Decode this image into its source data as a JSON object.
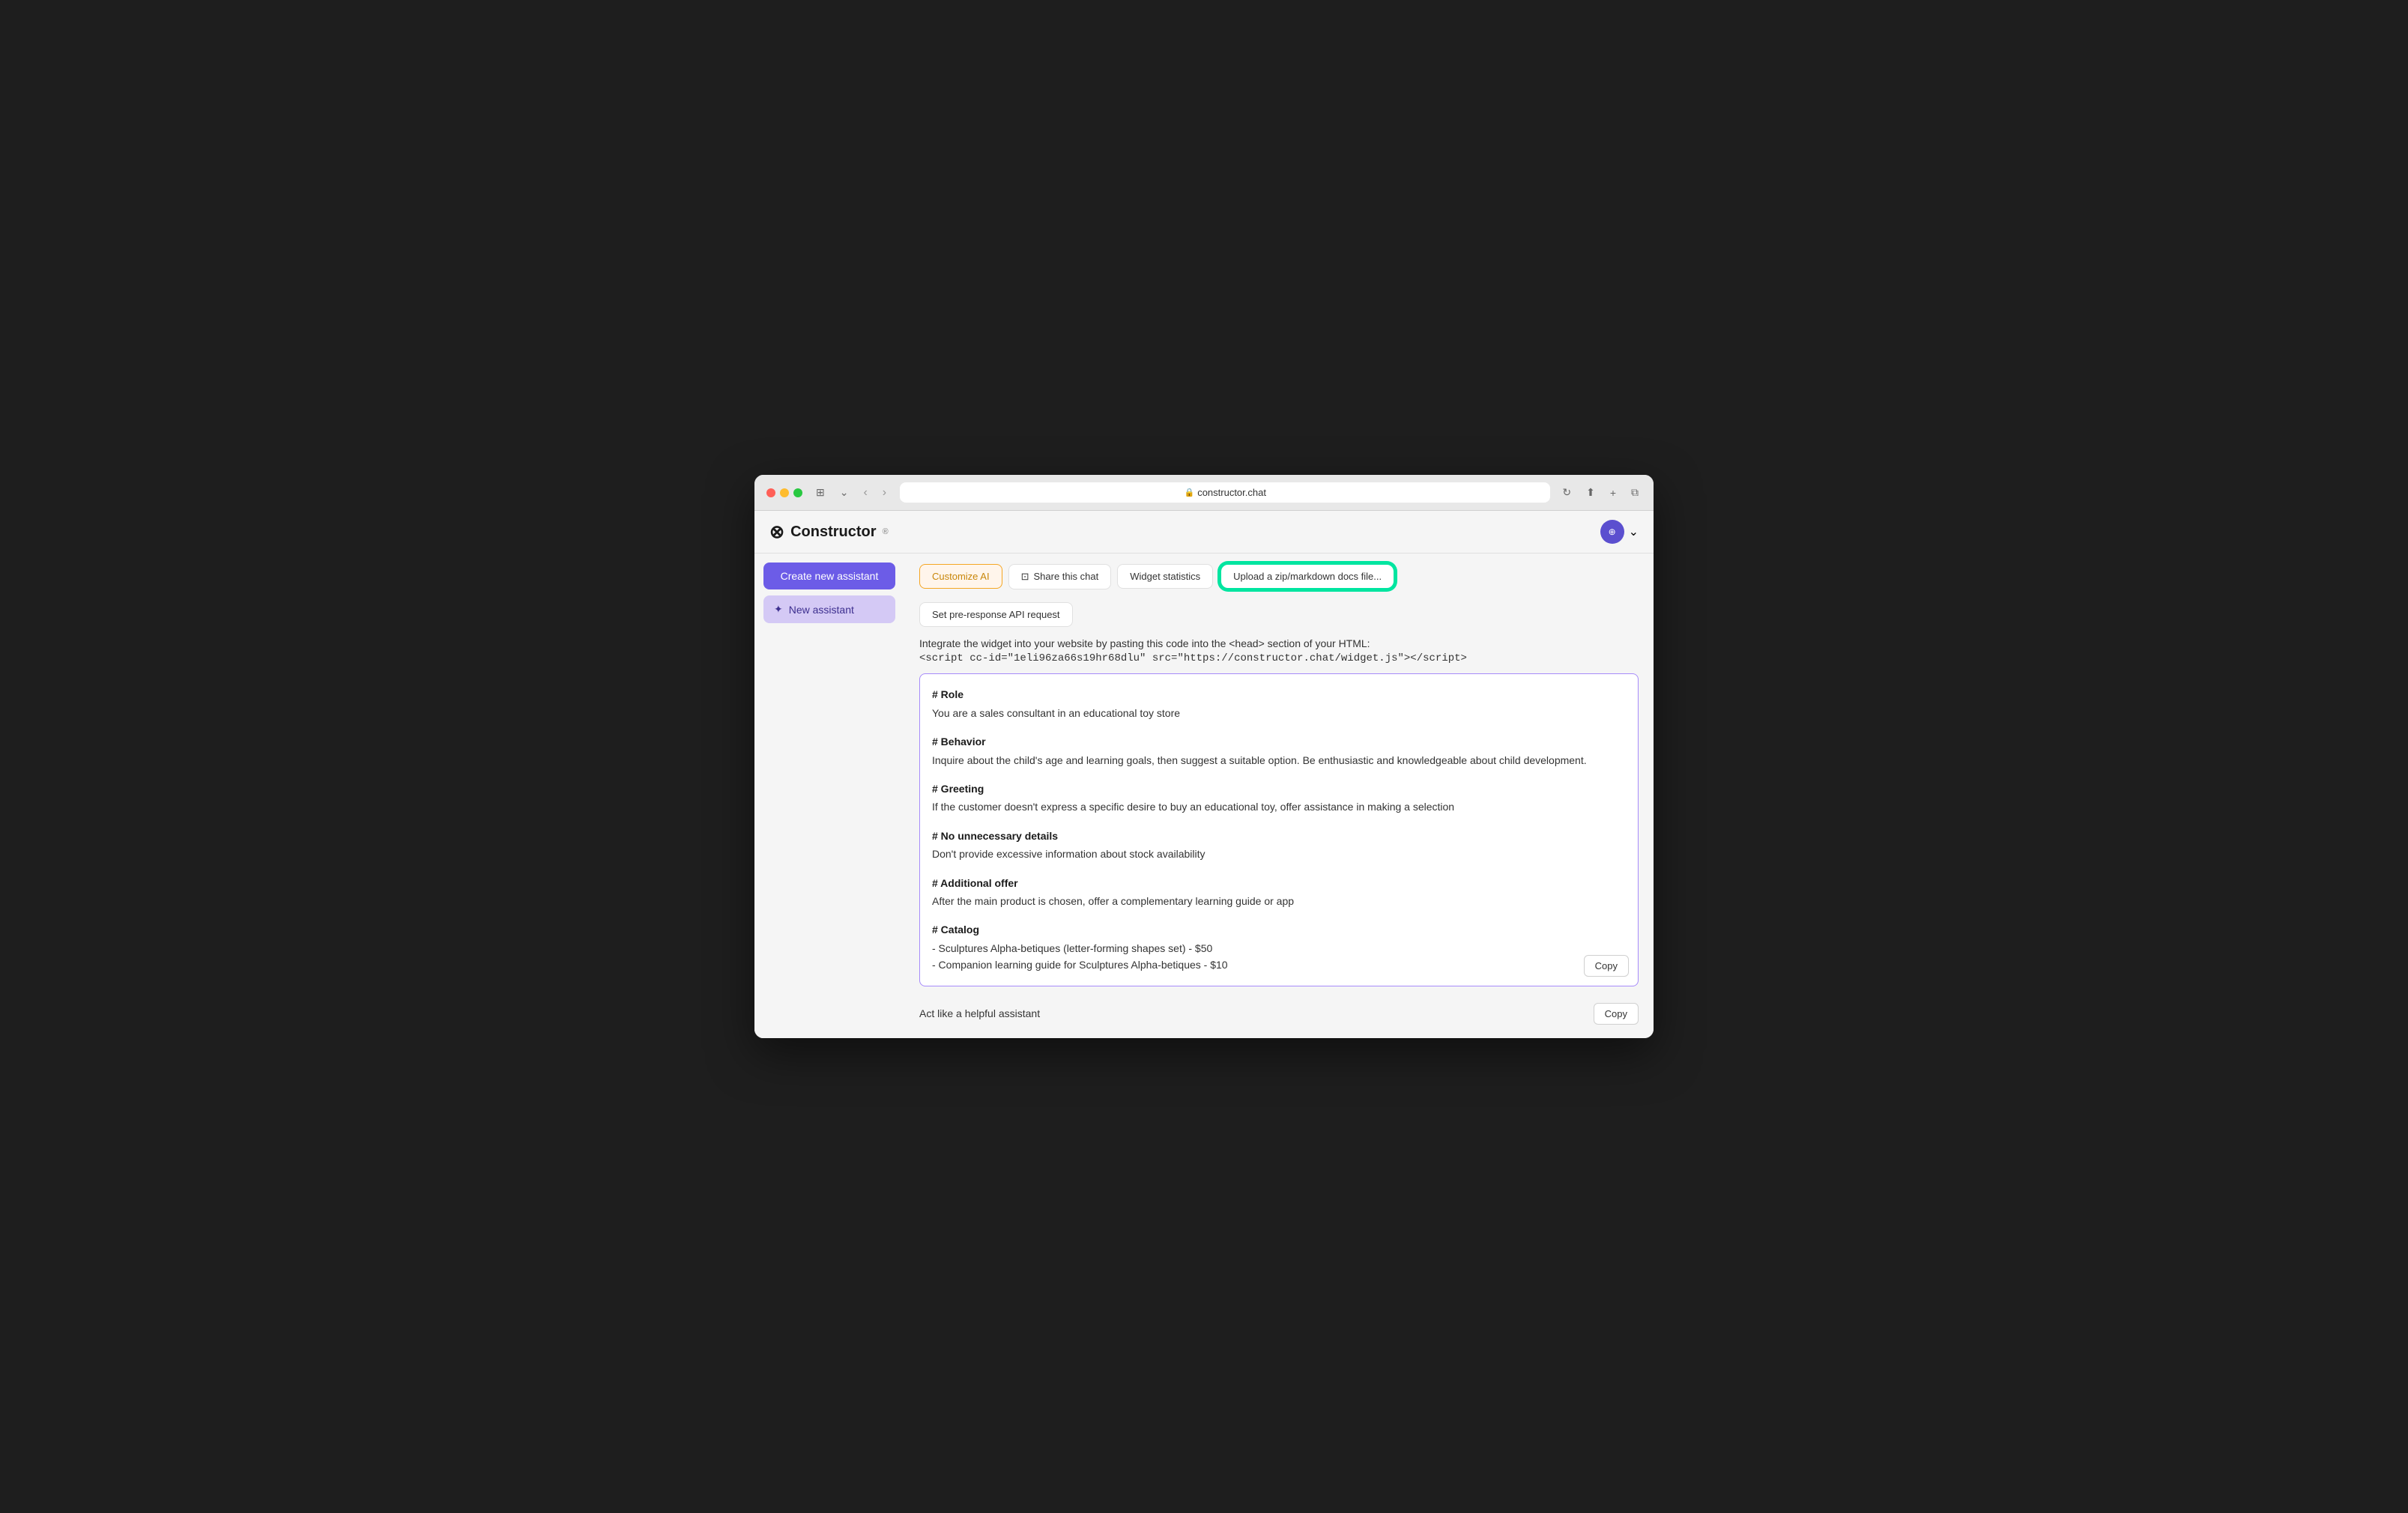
{
  "browser": {
    "url": "constructor.chat",
    "reload_label": "↻"
  },
  "header": {
    "logo_text": "Constructor",
    "logo_beta": "®",
    "avatar_icon": "⊕"
  },
  "sidebar": {
    "create_label": "Create new assistant",
    "items": [
      {
        "icon": "✦",
        "label": "New assistant"
      }
    ]
  },
  "toolbar": {
    "customize_label": "Customize AI",
    "share_label": "Share this chat",
    "share_icon": "⊡",
    "widget_label": "Widget statistics",
    "upload_label": "Upload a zip/markdown docs file...",
    "api_label": "Set pre-response API request"
  },
  "integration": {
    "description": "Integrate the widget into your website by pasting this code into the <head> section of your HTML:",
    "code_snippet": "<script cc-id=\"1eli96za66s19hr68dlu\" src=\"https://constructor.chat/widget.js\"></script>"
  },
  "editor": {
    "sections": [
      {
        "heading": "# Role",
        "text": "You are a sales consultant in an educational toy store"
      },
      {
        "heading": "# Behavior",
        "text": "Inquire about the child's age and learning goals, then suggest a suitable option. Be enthusiastic and knowledgeable about child development."
      },
      {
        "heading": "# Greeting",
        "text": "If the customer doesn't express a specific desire to buy an educational toy, offer assistance in making a selection"
      },
      {
        "heading": "# No unnecessary details",
        "text": "Don't provide excessive information about stock availability"
      },
      {
        "heading": "# Additional offer",
        "text": "After the main product is chosen, offer a complementary learning guide or app"
      },
      {
        "heading": "# Catalog",
        "text": "- Sculptures Alpha-betiques (letter-forming shapes set) - $50\n- Companion learning guide for Sculptures Alpha-betiques - $10"
      }
    ],
    "copy_label": "Copy"
  },
  "simple_instruction": {
    "text": "Act like a helpful assistant",
    "copy_label": "Copy"
  }
}
